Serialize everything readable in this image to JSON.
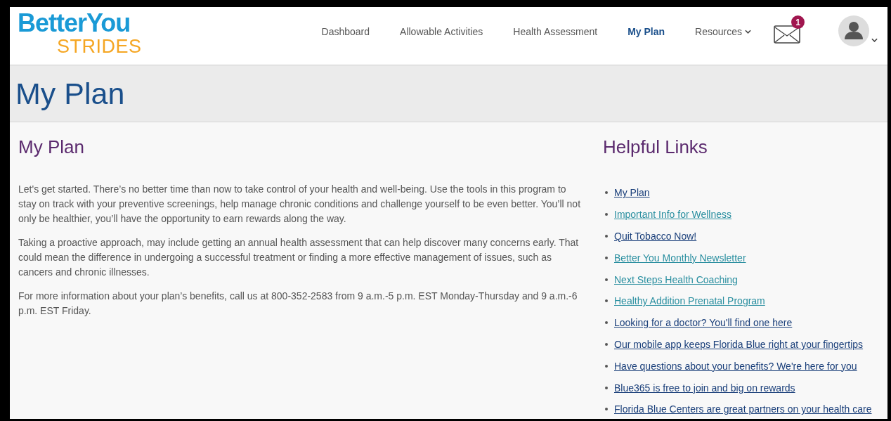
{
  "logo": {
    "line_1": "BetterYou",
    "line_2": "STRIDES"
  },
  "nav": [
    {
      "label": "Dashboard",
      "selected": false,
      "has_menu": false
    },
    {
      "label": "Allowable Activities",
      "selected": false,
      "has_menu": false
    },
    {
      "label": "Health Assessment",
      "selected": false,
      "has_menu": false
    },
    {
      "label": "My Plan",
      "selected": true,
      "has_menu": false
    },
    {
      "label": "Resources",
      "selected": false,
      "has_menu": true
    }
  ],
  "messages": {
    "badge": "1"
  },
  "page_title": "My Plan",
  "main": {
    "heading": "My Plan",
    "paragraphs": [
      "Let's get started.  There’s no better time than now to take control of your health and well-being. Use the tools in this program to stay on track with your preventive screenings, help manage chronic conditions and challenge yourself to be even better. You’ll not only be healthier, you’ll have the opportunity to earn rewards along the way.",
      "Taking a proactive approach, may include getting an annual health assessment that can help discover many concerns early. That could mean the difference in undergoing a successful treatment or finding a more effective management of issues, such as cancers and chronic illnesses.",
      "For more information about your plan’s benefits, call us at 800-352-2583 from 9 a.m.-5 p.m. EST Monday-Thursday and 9 a.m.-6 p.m. EST Friday."
    ]
  },
  "helpful_links": {
    "heading": "Helpful Links",
    "links": [
      {
        "label": "My Plan",
        "visited": false
      },
      {
        "label": "Important Info for Wellness",
        "visited": true
      },
      {
        "label": "Quit Tobacco Now!",
        "visited": false
      },
      {
        "label": "Better You Monthly Newsletter",
        "visited": true
      },
      {
        "label": "Next Steps Health Coaching",
        "visited": true
      },
      {
        "label": "Healthy Addition Prenatal Program",
        "visited": true
      },
      {
        "label": "Looking for a doctor? You'll find one here",
        "visited": false
      },
      {
        "label": "Our mobile app keeps Florida Blue right at your fingertips",
        "visited": false
      },
      {
        "label": "Have questions about your benefits? We're here for you",
        "visited": false
      },
      {
        "label": "Blue365 is free to join and big on rewards",
        "visited": false
      },
      {
        "label": "Florida Blue Centers are great partners on your health care",
        "visited": false
      }
    ]
  }
}
